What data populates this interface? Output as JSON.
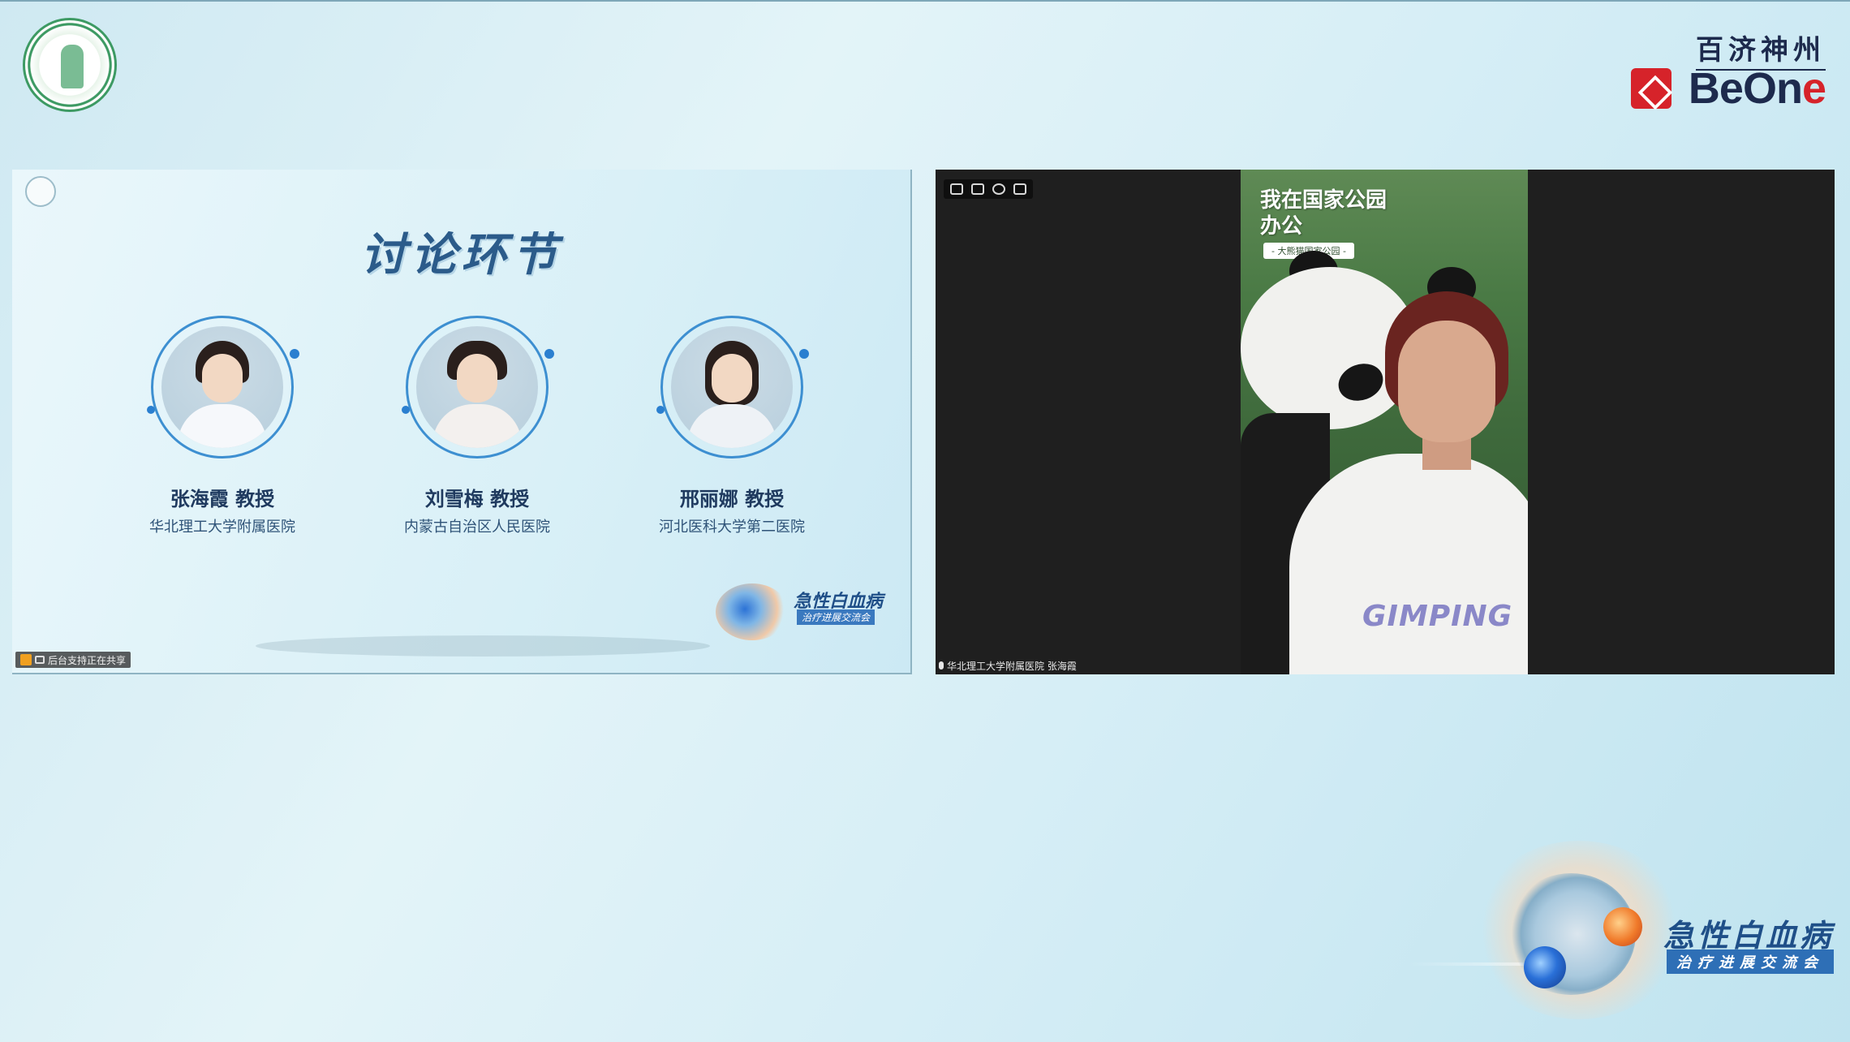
{
  "brand": {
    "cn": "百济神州",
    "en_prefix": "BeOn",
    "en_suffix": "e"
  },
  "slide": {
    "title": "讨论环节",
    "speakers": [
      {
        "name": "张海霞 教授",
        "org": "华北理工大学附属医院"
      },
      {
        "name": "刘雪梅 教授",
        "org": "内蒙古自治区人民医院"
      },
      {
        "name": "邢丽娜 教授",
        "org": "河北医科大学第二医院"
      }
    ],
    "event_title": "急性白血病",
    "event_sub": "治疗进展交流会",
    "share_status": "后台支持正在共享"
  },
  "video": {
    "background_title": "我在国家公园办公",
    "background_sub": "- 大熊猫国家公园 -",
    "shirt_print": "GIMPING",
    "participant_label": "华北理工大学附属医院 张海霞"
  },
  "event": {
    "title": "急性白血病",
    "sub": "治疗进展交流会"
  },
  "colors": {
    "brand_red": "#d6232a",
    "brand_navy": "#1d2a4d",
    "title_blue": "#2b5b8a",
    "accent_blue": "#2e6fb6"
  }
}
